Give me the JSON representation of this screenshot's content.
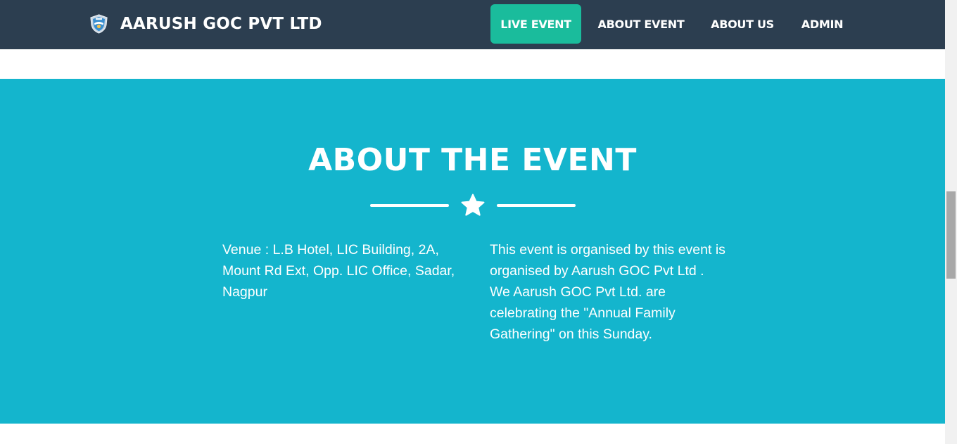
{
  "header": {
    "brand_name": "AARUSH GOC PVT LTD",
    "logo_icon": "shield-logo-icon",
    "nav": [
      {
        "label": "LIVE EVENT",
        "active": true
      },
      {
        "label": "ABOUT EVENT",
        "active": false
      },
      {
        "label": "ABOUT US",
        "active": false
      },
      {
        "label": "ADMIN",
        "active": false
      }
    ]
  },
  "about": {
    "title": "ABOUT THE EVENT",
    "divider_icon": "star-icon",
    "venue_text": "Venue : L.B Hotel, LIC Building, 2A, Mount Rd Ext, Opp. LIC Office, Sadar, Nagpur",
    "description_text": "This event is organised by this event is organised by Aarush GOC Pvt Ltd . We Aarush GOC Pvt Ltd. are celebrating the \"Annual Family Gathering\" on this Sunday."
  },
  "colors": {
    "navbar_bg": "#2c3e50",
    "active_nav_bg": "#1abc9c",
    "section_bg": "#14b5cd",
    "text": "#ffffff"
  }
}
